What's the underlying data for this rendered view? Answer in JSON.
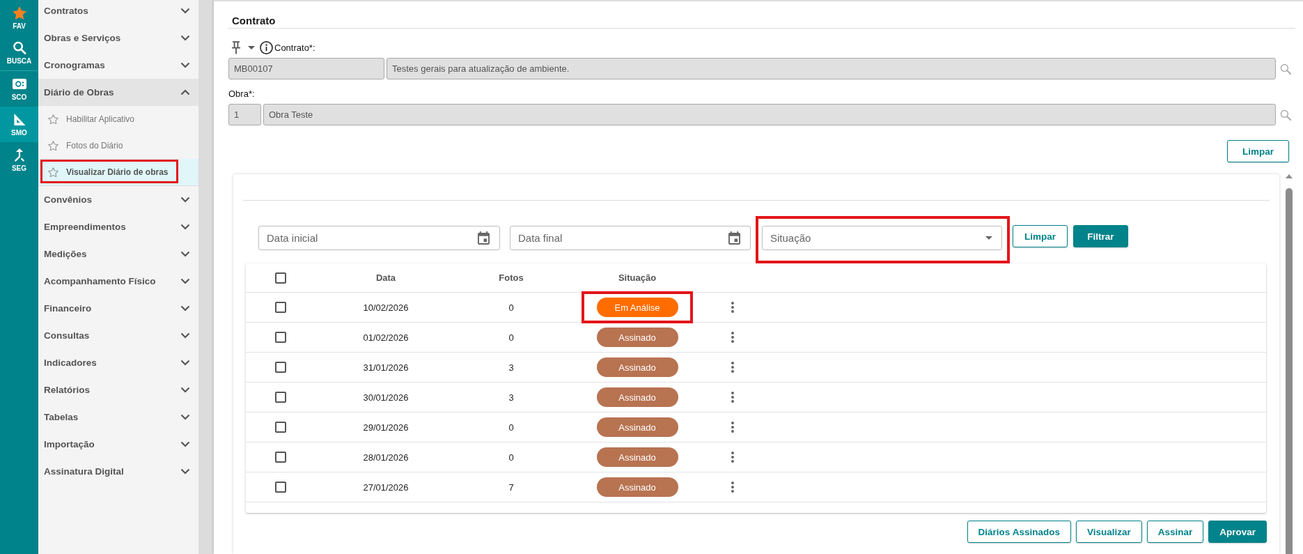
{
  "rail": [
    {
      "label": "FAV",
      "selected": false
    },
    {
      "label": "BUSCA",
      "selected": false
    },
    {
      "label": "SCO",
      "selected": false
    },
    {
      "label": "SMO",
      "selected": true
    },
    {
      "label": "SEG",
      "selected": false
    }
  ],
  "sidebar": {
    "items": [
      {
        "label": "Contratos",
        "expanded": false
      },
      {
        "label": "Obras e Serviços",
        "expanded": false
      },
      {
        "label": "Cronogramas",
        "expanded": false
      },
      {
        "label": "Diário de Obras",
        "expanded": true,
        "children": [
          {
            "label": "Habilitar Aplicativo",
            "selected": false,
            "annotated": false
          },
          {
            "label": "Fotos do Diário",
            "selected": false,
            "annotated": false
          },
          {
            "label": "Visualizar Diário de obras",
            "selected": true,
            "annotated": true
          }
        ]
      },
      {
        "label": "Convênios",
        "expanded": false
      },
      {
        "label": "Empreendimentos",
        "expanded": false
      },
      {
        "label": "Medições",
        "expanded": false
      },
      {
        "label": "Acompanhamento Físico",
        "expanded": false
      },
      {
        "label": "Financeiro",
        "expanded": false
      },
      {
        "label": "Consultas",
        "expanded": false
      },
      {
        "label": "Indicadores",
        "expanded": false
      },
      {
        "label": "Relatórios",
        "expanded": false
      },
      {
        "label": "Tabelas",
        "expanded": false
      },
      {
        "label": "Importação",
        "expanded": false
      },
      {
        "label": "Assinatura Digital",
        "expanded": false
      }
    ]
  },
  "contract_section": {
    "title": "Contrato",
    "contract": {
      "label": "Contrato*:",
      "code": "MB00107",
      "description": "Testes gerais para atualização de ambiente.",
      "disabled": true
    },
    "work": {
      "label": "Obra*:",
      "code": "1",
      "description": "Obra Teste",
      "disabled": true
    },
    "clear_button": "Limpar"
  },
  "diary": {
    "filters": {
      "start_date": {
        "placeholder": "Data inicial"
      },
      "end_date": {
        "placeholder": "Data final"
      },
      "status": {
        "placeholder": "Situação",
        "annotated": true
      },
      "buttons": [
        {
          "label": "Limpar",
          "primary": false
        },
        {
          "label": "Filtrar",
          "primary": true
        }
      ]
    },
    "table": {
      "columns": [
        "Data",
        "Fotos",
        "Situação"
      ],
      "all_checked": false,
      "rows": [
        {
          "checked": false,
          "date": "10/02/2026",
          "photos": "0",
          "status": "Em Análise",
          "color": "#ff6d00",
          "annotated": true
        },
        {
          "checked": false,
          "date": "01/02/2026",
          "photos": "0",
          "status": "Assinado",
          "color": "#b87351",
          "annotated": false
        },
        {
          "checked": false,
          "date": "31/01/2026",
          "photos": "3",
          "status": "Assinado",
          "color": "#b87351",
          "annotated": false
        },
        {
          "checked": false,
          "date": "30/01/2026",
          "photos": "3",
          "status": "Assinado",
          "color": "#b87351",
          "annotated": false
        },
        {
          "checked": false,
          "date": "29/01/2026",
          "photos": "0",
          "status": "Assinado",
          "color": "#b87351",
          "annotated": false
        },
        {
          "checked": false,
          "date": "28/01/2026",
          "photos": "0",
          "status": "Assinado",
          "color": "#b87351",
          "annotated": false
        },
        {
          "checked": false,
          "date": "27/01/2026",
          "photos": "7",
          "status": "Assinado",
          "color": "#b87351",
          "annotated": false
        }
      ]
    },
    "actions": [
      {
        "label": "Diários Assinados",
        "primary": false
      },
      {
        "label": "Visualizar",
        "primary": false
      },
      {
        "label": "Assinar",
        "primary": false
      },
      {
        "label": "Aprovar",
        "primary": true
      }
    ]
  }
}
